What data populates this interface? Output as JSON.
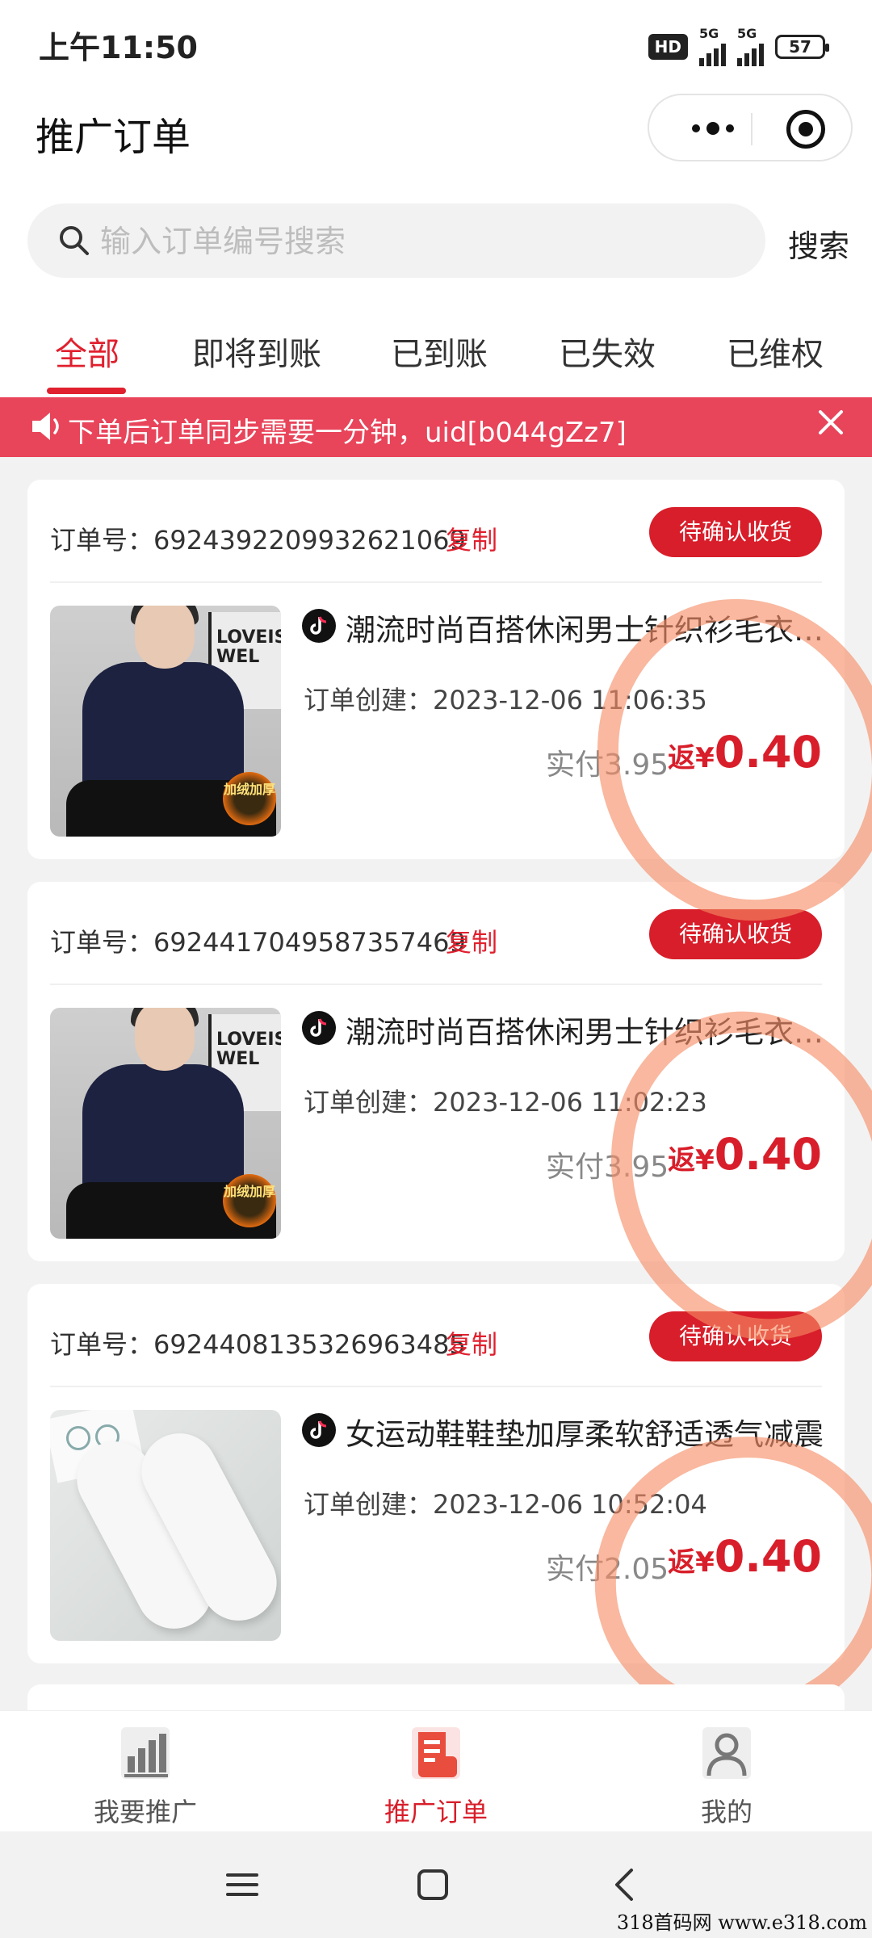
{
  "status_bar": {
    "time": "上午11:50",
    "hd_label": "HD",
    "network_1": "5G",
    "network_2": "5G",
    "battery": "57"
  },
  "header": {
    "title": "推广订单"
  },
  "search": {
    "placeholder": "输入订单编号搜索",
    "button_label": "搜索"
  },
  "tabs": [
    {
      "label": "全部",
      "active": true
    },
    {
      "label": "即将到账",
      "active": false
    },
    {
      "label": "已到账",
      "active": false
    },
    {
      "label": "已失效",
      "active": false
    },
    {
      "label": "已维权",
      "active": false
    }
  ],
  "notice": {
    "text": "下单后订单同步需要一分钟，uid[b044gZz7]"
  },
  "orders": [
    {
      "order_label": "订单号：",
      "order_no": "6924392209932621069",
      "copy_label": "复制",
      "status": "待确认收货",
      "title": "潮流时尚百搭休闲男士针织衫毛衣加绒加厚",
      "created_label": "订单创建：",
      "created_at": "2023-12-06 11:06:35",
      "paid_label": "实付",
      "paid_amount": "3.95",
      "rebate_prefix": "返¥",
      "rebate_amount": "0.40",
      "badge_text": "加绒加厚",
      "sign_text": "LOVEIS WEL"
    },
    {
      "order_label": "订单号：",
      "order_no": "6924417049587357469",
      "copy_label": "复制",
      "status": "待确认收货",
      "title": "潮流时尚百搭休闲男士针织衫毛衣加绒加厚",
      "created_label": "订单创建：",
      "created_at": "2023-12-06 11:02:23",
      "paid_label": "实付",
      "paid_amount": "3.95",
      "rebate_prefix": "返¥",
      "rebate_amount": "0.40",
      "badge_text": "加绒加厚",
      "sign_text": "LOVEIS WEL"
    },
    {
      "order_label": "订单号：",
      "order_no": "6924408135326963485",
      "copy_label": "复制",
      "status": "待确认收货",
      "title": "女运动鞋鞋垫加厚柔软舒适透气减震",
      "created_label": "订单创建：",
      "created_at": "2023-12-06 10:52:04",
      "paid_label": "实付",
      "paid_amount": "2.05",
      "rebate_prefix": "返¥",
      "rebate_amount": "0.40"
    }
  ],
  "bottom_nav": [
    {
      "label": "我要推广",
      "icon": "bar-chart-icon",
      "active": false
    },
    {
      "label": "推广订单",
      "icon": "order-list-icon",
      "active": true
    },
    {
      "label": "我的",
      "icon": "person-icon",
      "active": false
    }
  ],
  "colors": {
    "accent": "#d81e2a",
    "notice_bg": "#e8445a",
    "annotation_circle": "#f68c64"
  },
  "watermark": "318首码网  www.e318.com"
}
